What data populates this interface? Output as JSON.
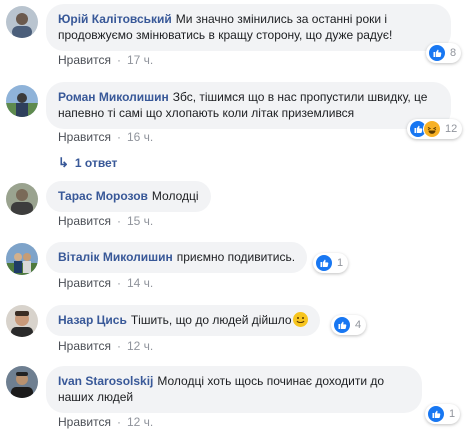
{
  "comments": [
    {
      "author": "Юрій Калітовський",
      "text": "Ми значно змінились за останні роки і продовжуємо змінюватись в кращу сторону, що дуже радує!",
      "like_label": "Нравится",
      "time": "17 ч.",
      "reaction_count": "8"
    },
    {
      "author": "Роман Миколишин",
      "text": "Збс, тішимся що в нас пропустили швидку, це напевно ті самі що хлопають коли літак приземлився",
      "like_label": "Нравится",
      "time": "16 ч.",
      "reaction_count": "12",
      "replies_label": "1 ответ"
    },
    {
      "author": "Тарас Морозов",
      "text": "Молодці",
      "like_label": "Нравится",
      "time": "15 ч."
    },
    {
      "author": "Віталік Миколишин",
      "text": "приємно подивитись.",
      "like_label": "Нравится",
      "time": "14 ч.",
      "reaction_count": "1"
    },
    {
      "author": "Назар Цись",
      "text": "Тішить, що до людей дійшло",
      "like_label": "Нравится",
      "time": "12 ч.",
      "reaction_count": "4"
    },
    {
      "author": "Ivan Starosolskij",
      "text": "Молодці хоть щось починає доходити до наших людей",
      "like_label": "Нравится",
      "time": "12 ч.",
      "reaction_count": "1"
    }
  ],
  "separator": "·",
  "colors": {
    "author": "#385898",
    "bubble": "#f2f3f5",
    "meta": "#90949c",
    "like": "#1877f2"
  },
  "icons": [
    "like-icon",
    "haha-icon",
    "smile-emoji-icon",
    "reply-arrow-icon"
  ]
}
